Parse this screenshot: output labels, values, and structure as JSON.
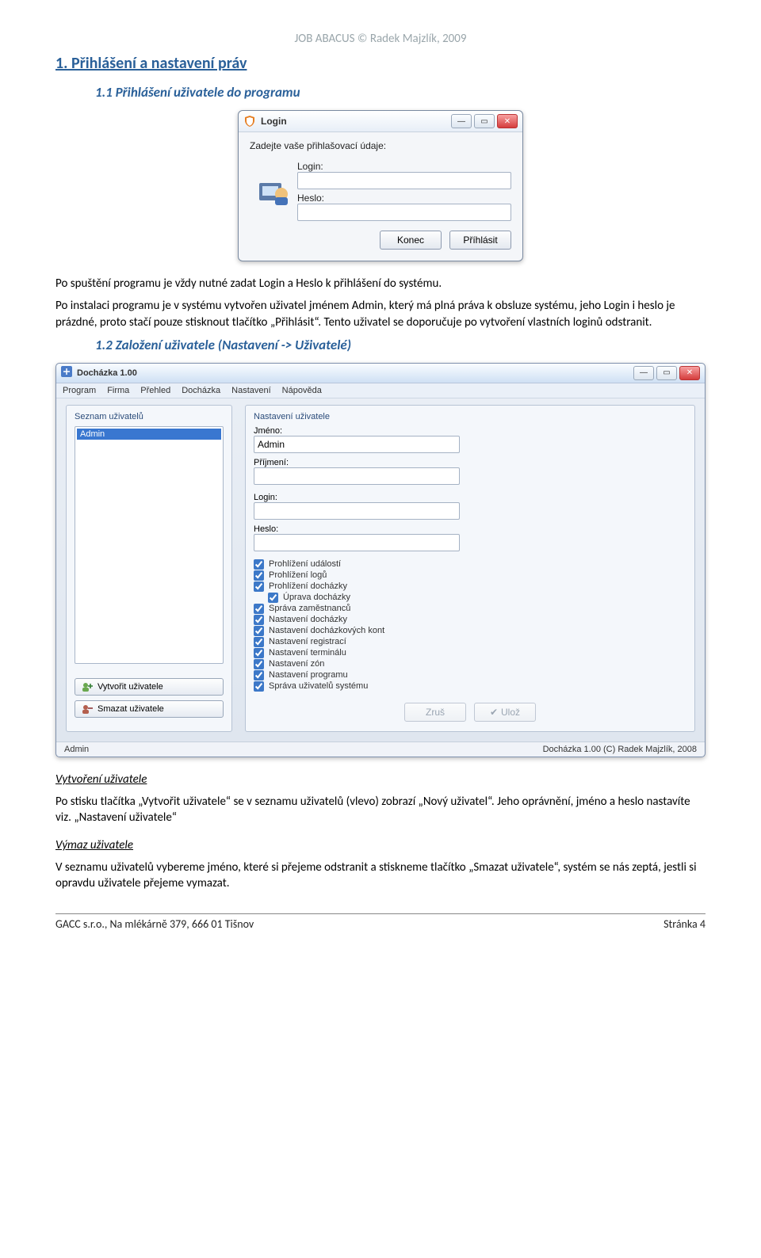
{
  "header_line": "JOB ABACUS © Radek Majzlík, 2009",
  "section_title": "1. Přihlášení a nastavení práv",
  "sub1": "1.1 Přihlášení uživatele do programu",
  "para1": "Po spuštění programu je vždy nutné zadat Login a Heslo k přihlášení do systému.",
  "para2": "Po instalaci programu je v systému vytvořen uživatel jménem Admin, který má plná práva k obsluze systému, jeho Login i heslo je prázdné, proto stačí pouze stisknout tlačítko „Přihlásit“. Tento uživatel se doporučuje po vytvoření vlastních loginů odstranit.",
  "sub2": "1.2 Založení uživatele (Nastavení -> Uživatelé)",
  "create_title": "Vytvoření uživatele",
  "create_para": "Po stisku tlačítka „Vytvořit uživatele“ se v seznamu uživatelů (vlevo) zobrazí „Nový uživatel“. Jeho oprávnění, jméno a heslo nastavíte viz. „Nastavení uživatele“",
  "delete_title": "Výmaz uživatele",
  "delete_para": "V seznamu uživatelů vybereme jméno, které si přejeme odstranit a stiskneme tlačítko „Smazat uživatele“, systém se nás zeptá, jestli si opravdu uživatele přejeme vymazat.",
  "login": {
    "title": "Login",
    "prompt": "Zadejte vaše přihlašovací údaje:",
    "login_label": "Login:",
    "pass_label": "Heslo:",
    "btn_exit": "Konec",
    "btn_login": "Příhlásit"
  },
  "app": {
    "title": "Docházka 1.00",
    "menu": [
      "Program",
      "Firma",
      "Přehled",
      "Docházka",
      "Nastavení",
      "Nápověda"
    ],
    "left_title": "Seznam uživatelů",
    "user_selected": "Admin",
    "btn_create": "Vytvořit uživatele",
    "btn_delete": "Smazat uživatele",
    "right_title": "Nastavení uživatele",
    "f_jmeno": "Jméno:",
    "f_jmeno_val": "Admin",
    "f_prijmeni": "Příjmení:",
    "f_login": "Login:",
    "f_heslo": "Heslo:",
    "checks": [
      {
        "label": "Prohlížení událostí",
        "chk": true,
        "indent": false
      },
      {
        "label": "Prohlížení logů",
        "chk": true,
        "indent": false
      },
      {
        "label": "Prohlížení docházky",
        "chk": true,
        "indent": false
      },
      {
        "label": "Úprava docházky",
        "chk": true,
        "indent": true
      },
      {
        "label": "Správa zaměstnanců",
        "chk": true,
        "indent": false
      },
      {
        "label": "Nastavení docházky",
        "chk": true,
        "indent": false
      },
      {
        "label": "Nastavení docházkových kont",
        "chk": true,
        "indent": false
      },
      {
        "label": "Nastavení registrací",
        "chk": true,
        "indent": false
      },
      {
        "label": "Nastavení terminálu",
        "chk": true,
        "indent": false
      },
      {
        "label": "Nastavení zón",
        "chk": true,
        "indent": false
      },
      {
        "label": "Nastavení programu",
        "chk": true,
        "indent": false
      },
      {
        "label": "Správa uživatelů systému",
        "chk": true,
        "indent": false
      }
    ],
    "btn_cancel": "Zruš",
    "btn_save": "Ulož",
    "status_user": "Admin",
    "status_right": "Docházka 1.00 (C) Radek Majzlík, 2008"
  },
  "footer_left": "GACC s.r.o., Na mlékárně 379, 666 01 Tišnov",
  "footer_right": "Stránka 4"
}
